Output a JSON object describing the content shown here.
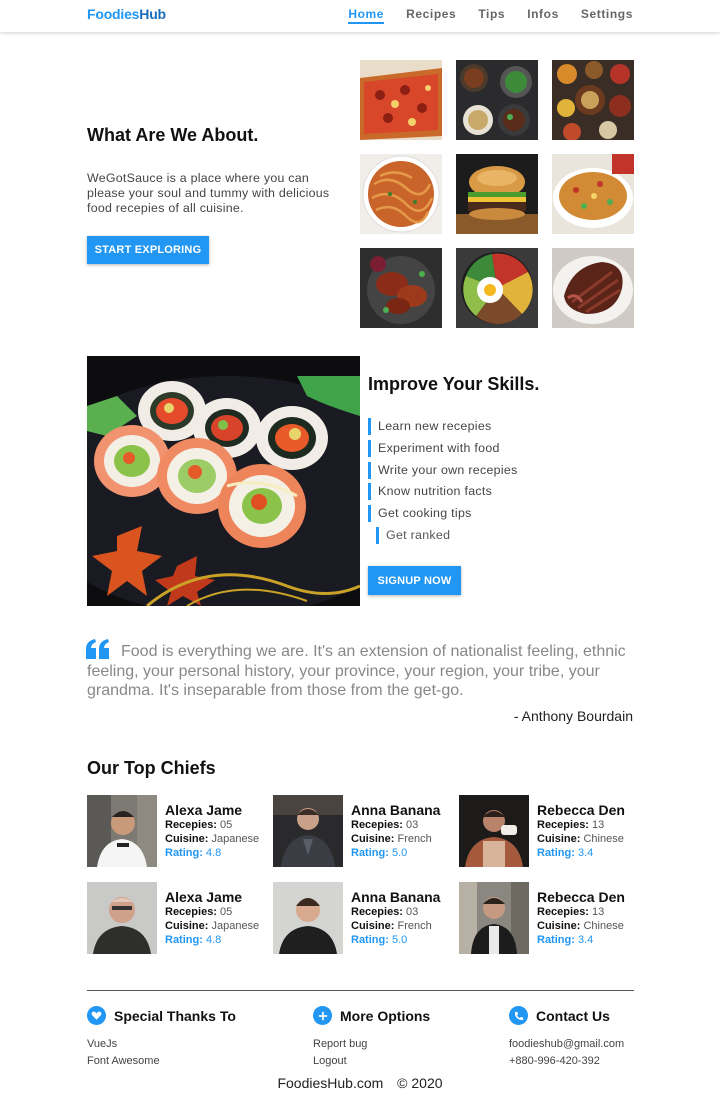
{
  "nav": {
    "logo_part1": "Foodies",
    "logo_part2": "Hub",
    "links": [
      "Home",
      "Recipes",
      "Tips",
      "Infos",
      "Settings"
    ]
  },
  "hero": {
    "title": "What Are We About.",
    "text": "WeGotSauce is a place where you can please your soul and tummy with delicious food recepies of all cuisine.",
    "button": "START EXPLORING",
    "gallery": [
      "pizza-image",
      "bowls-image",
      "platter-image",
      "noodles-image",
      "burger-image",
      "fried-rice-image",
      "grilled-chicken-image",
      "bibimbap-image",
      "steak-image"
    ]
  },
  "skills": {
    "title": "Improve Your Skills.",
    "items": [
      "Learn new recepies",
      "Experiment with food",
      "Write your own recepies",
      "Know nutrition facts",
      "Get cooking tips",
      "Get ranked"
    ],
    "button": "SIGNUP NOW"
  },
  "quote": {
    "text": "Food is everything we are. It's an extension of nationalist feeling, ethnic feeling, your personal history, your province, your region, your tribe, your grandma. It's inseparable from those from the get-go.",
    "author": "- Anthony Bourdain"
  },
  "chiefs": {
    "title": "Our Top Chiefs",
    "labels": {
      "recipes": "Recepies:",
      "cuisine": "Cuisine:",
      "rating": "Rating:"
    },
    "list": [
      {
        "name": "Alexa Jame",
        "recipes": "05",
        "cuisine": "Japanese",
        "rating": "4.8"
      },
      {
        "name": "Anna Banana",
        "recipes": "03",
        "cuisine": "French",
        "rating": "5.0"
      },
      {
        "name": "Rebecca Den",
        "recipes": "13",
        "cuisine": "Chinese",
        "rating": "3.4"
      },
      {
        "name": "Alexa Jame",
        "recipes": "05",
        "cuisine": "Japanese",
        "rating": "4.8"
      },
      {
        "name": "Anna Banana",
        "recipes": "03",
        "cuisine": "French",
        "rating": "5.0"
      },
      {
        "name": "Rebecca Den",
        "recipes": "13",
        "cuisine": "Chinese",
        "rating": "3.4"
      }
    ]
  },
  "footer": {
    "cols": [
      {
        "title": "Special Thanks To",
        "icon": "heart-icon",
        "items": [
          "VueJs",
          "Font Awesome"
        ]
      },
      {
        "title": "More Options",
        "icon": "plus-icon",
        "items": [
          "Report bug",
          "Logout"
        ]
      },
      {
        "title": "Contact Us",
        "icon": "phone-icon",
        "items": [
          "foodieshub@gmail.com",
          "+880-996-420-392"
        ]
      }
    ],
    "site": "FoodiesHub.com",
    "copyright": "© 2020"
  },
  "colors": {
    "accent": "#2196f3"
  }
}
